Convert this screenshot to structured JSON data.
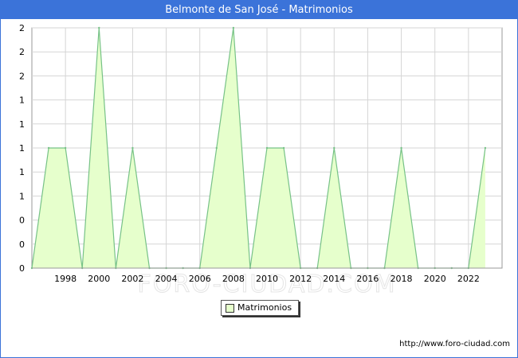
{
  "title": "Belmonte de San José - Matrimonios",
  "source": "http://www.foro-ciudad.com",
  "watermark": "FORO-CIUDAD.COM",
  "colors": {
    "header": "#3b73d9",
    "fill": "#e6ffcc",
    "line": "#77c287",
    "grid": "#d5d5d5"
  },
  "chart_data": {
    "type": "area",
    "title": "Belmonte de San José - Matrimonios",
    "xlabel": "",
    "ylabel": "",
    "x": [
      1996,
      1997,
      1998,
      1999,
      2000,
      2001,
      2002,
      2003,
      2004,
      2005,
      2006,
      2007,
      2008,
      2009,
      2010,
      2011,
      2012,
      2013,
      2014,
      2015,
      2016,
      2017,
      2018,
      2019,
      2020,
      2021,
      2022,
      2023
    ],
    "series": [
      {
        "name": "Matrimonios",
        "values": [
          0,
          1,
          1,
          0,
          2,
          0,
          1,
          0,
          0,
          0,
          0,
          1,
          2,
          0,
          1,
          1,
          0,
          0,
          1,
          0,
          0,
          0,
          1,
          0,
          0,
          0,
          0,
          1
        ]
      }
    ],
    "x_ticks": [
      "1998",
      "2000",
      "2002",
      "2004",
      "2006",
      "2008",
      "2010",
      "2012",
      "2014",
      "2016",
      "2018",
      "2020",
      "2022"
    ],
    "y_tick_labels": [
      "0",
      "0",
      "0",
      "1",
      "1",
      "1",
      "1",
      "1",
      "2",
      "2",
      "2"
    ],
    "ylim": [
      0,
      2
    ],
    "xlim": [
      1996,
      2024
    ],
    "grid": true,
    "legend_position": "bottom-center"
  }
}
